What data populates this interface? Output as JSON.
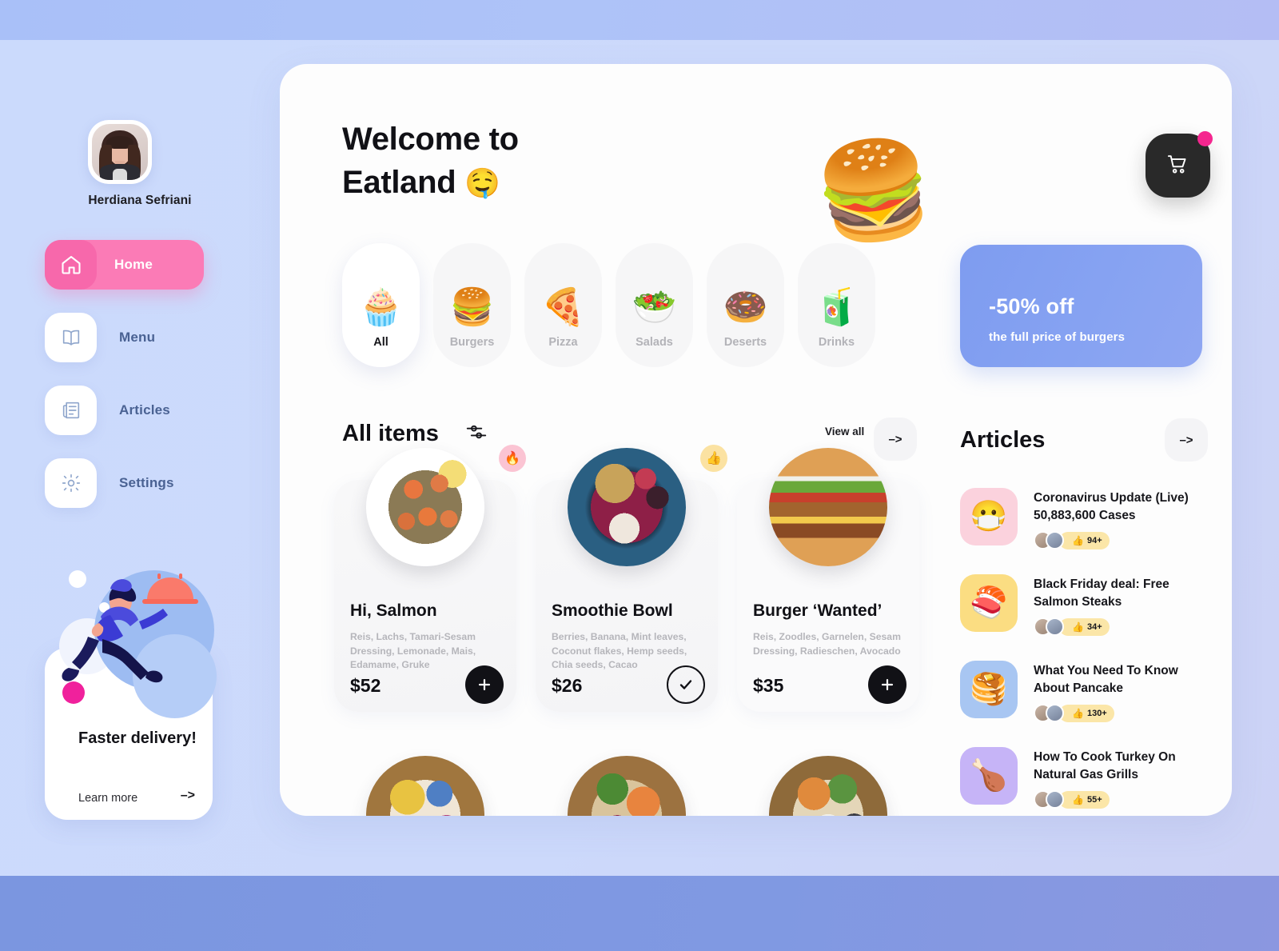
{
  "theme": {
    "accent_pink": "#fb7bb6",
    "accent_blue": "#7e9cf0",
    "panel_bg": "#fdfdfd",
    "page_bg": "#ccd9fb",
    "text_dark": "#111116",
    "text_muted": "#b6b6bb",
    "nav_label": "#4a6293"
  },
  "sidebar": {
    "user_name": "Herdiana Sefriani",
    "items": [
      {
        "label": "Home",
        "icon": "home-icon",
        "active": true
      },
      {
        "label": "Menu",
        "icon": "book-icon",
        "active": false
      },
      {
        "label": "Articles",
        "icon": "newspaper-icon",
        "active": false
      },
      {
        "label": "Settings",
        "icon": "gear-icon",
        "active": false
      }
    ],
    "promo": {
      "title": "Faster delivery!",
      "link_label": "Learn more",
      "arrow": "–>"
    }
  },
  "header": {
    "welcome_line1": "Welcome to",
    "welcome_line2": "Eatland",
    "welcome_emoji": "🤤",
    "search_icon": "search-icon",
    "cart_icon": "shopping-cart-icon",
    "cart_has_notification": true
  },
  "categories": [
    {
      "label": "All",
      "emoji": "🧁",
      "active": true
    },
    {
      "label": "Burgers",
      "emoji": "🍔",
      "active": false
    },
    {
      "label": "Pizza",
      "emoji": "🍕",
      "active": false
    },
    {
      "label": "Salads",
      "emoji": "🥗",
      "active": false
    },
    {
      "label": "Deserts",
      "emoji": "🍩",
      "active": false
    },
    {
      "label": "Drinks",
      "emoji": "🧃",
      "active": false
    }
  ],
  "banner": {
    "title": "-50% off",
    "subtitle": "the full price of burgers",
    "emoji": "🍔",
    "color": "#7e9cf0"
  },
  "items_section": {
    "title": "All items",
    "filter_icon": "filter-sliders-icon",
    "view_all_label": "View all",
    "view_all_arrow": "–>",
    "items": [
      {
        "name": "Hi, Salmon",
        "description": "Reis, Lachs, Tamari-Sesam Dressing, Lemonade, Mais, Edamame, Gruke",
        "price": "$52",
        "badge": "🔥",
        "badge_kind": "hot",
        "action": "add",
        "action_glyph": "+",
        "image": "salmon-rice-bowl"
      },
      {
        "name": "Smoothie Bowl",
        "description": "Berries, Banana, Mint leaves, Coconut flakes, Hemp seeds, Chia seeds, Cacao",
        "price": "$26",
        "badge": "👍",
        "badge_kind": "like",
        "action": "added",
        "action_glyph": "✓",
        "image": "smoothie-bowl"
      },
      {
        "name": "Burger ‘Wanted’",
        "description": "Reis, Zoodles, Garnelen, Sesam Dressing, Radieschen, Avocado",
        "price": "$35",
        "badge": "",
        "badge_kind": "none",
        "action": "add",
        "action_glyph": "+",
        "image": "burger-wanted"
      }
    ],
    "second_row": [
      {
        "image": "veggie-bowl-rainbow"
      },
      {
        "image": "salmon-grain-bowl"
      },
      {
        "image": "sushi-poke-bowl"
      }
    ]
  },
  "articles_section": {
    "title": "Articles",
    "arrow": "–>",
    "articles": [
      {
        "title": "Coronavirus Update (Live) 50,883,600 Cases",
        "emoji": "😷",
        "thumb_color": "#fbd2dd",
        "likes": "94+",
        "like_icon": "👍"
      },
      {
        "title": "Black Friday deal: Free Salmon Steaks",
        "emoji": "🍣",
        "thumb_color": "#fbdd82",
        "likes": "34+",
        "like_icon": "👍"
      },
      {
        "title": "What You Need To Know About Pancake",
        "emoji": "🥞",
        "thumb_color": "#a8c6f2",
        "likes": "130+",
        "like_icon": "👍"
      },
      {
        "title": "How To Cook Turkey On Natural Gas Grills",
        "emoji": "🍗",
        "thumb_color": "#c6b4f7",
        "likes": "55+",
        "like_icon": "👍"
      }
    ]
  }
}
